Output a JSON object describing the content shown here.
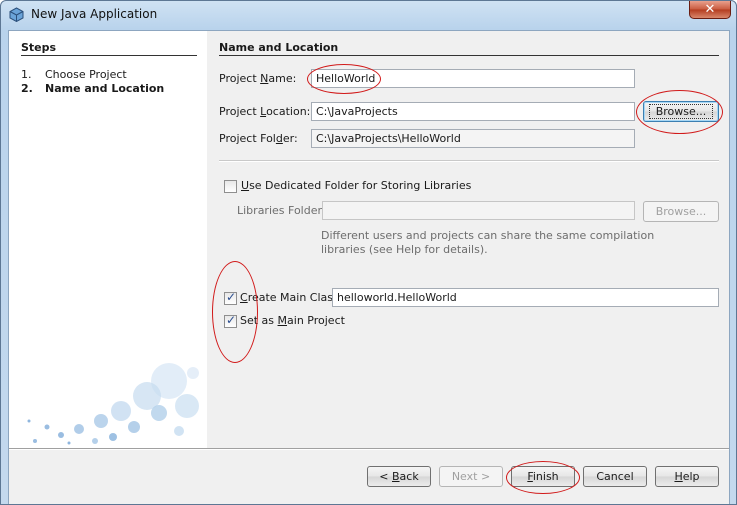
{
  "window": {
    "title": "New Java Application",
    "close_glyph": "✕"
  },
  "steps": {
    "heading": "Steps",
    "items": [
      {
        "num": "1.",
        "label": "Choose Project"
      },
      {
        "num": "2.",
        "label": "Name and Location"
      }
    ]
  },
  "section": {
    "title": "Name and Location"
  },
  "project_name": {
    "label": "Project Name:",
    "value": "HelloWorld"
  },
  "project_location": {
    "label": "Project Location:",
    "value": "C:\\JavaProjects",
    "browse": "Browse..."
  },
  "project_folder": {
    "label": "Project Folder:",
    "value": "C:\\JavaProjects\\HelloWorld"
  },
  "libraries": {
    "checkbox_label": "Use Dedicated Folder for Storing Libraries",
    "checked": false,
    "folder_label": "Libraries Folder:",
    "folder_value": "",
    "browse": "Browse...",
    "hint_line1": "Different users and projects can share the same compilation",
    "hint_line2": "libraries (see Help for details)."
  },
  "main_class": {
    "label": "Create Main Class",
    "checked": true,
    "value": "helloworld.HelloWorld"
  },
  "main_project": {
    "label": "Set as Main Project",
    "checked": true
  },
  "buttons": {
    "back": "< Back",
    "next": "Next >",
    "finish": "Finish",
    "cancel": "Cancel",
    "help": "Help"
  },
  "colors": {
    "annotation": "#d11a1a",
    "title_bar": "#c4d9ee",
    "panel": "#f0f0f0"
  }
}
